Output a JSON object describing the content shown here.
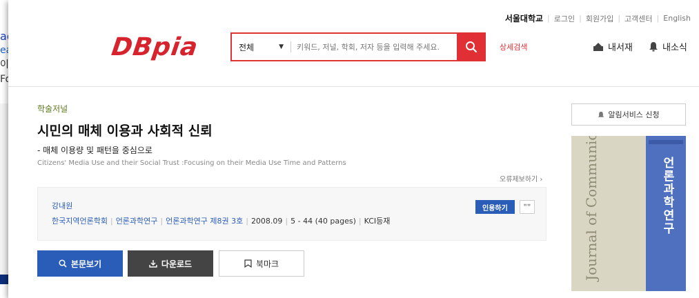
{
  "background_window": {
    "lines": [
      "ae",
      "ear",
      "이용.",
      "Foc"
    ]
  },
  "topbar": {
    "institution": "서울대학교",
    "links": [
      "로그인",
      "회원가입",
      "고객센터",
      "English"
    ]
  },
  "header": {
    "logo": "DBpia",
    "search": {
      "scope": "전체",
      "placeholder": "키워드, 저널, 학회, 저자 등을 입력해 주세요."
    },
    "advanced_search": "상세검색",
    "my_library": "내서재",
    "my_news": "내소식"
  },
  "article": {
    "category": "학술저널",
    "title": "시민의 매체 이용과 사회적 신뢰",
    "subtitle": "- 매체 이용량 및 패턴을 중심으로",
    "english_title": "Citizens' Media Use and their Social Trust :Focusing on their Media Use Time and Patterns",
    "report_error": "오류제보하기",
    "author": "강내원",
    "publisher": "한국지역언론학회",
    "journal": "언론과학연구",
    "issue": "언론과학연구 제8권 3호",
    "date": "2008.09",
    "pages": "5 - 44 (40 pages)",
    "index": "KCI등재",
    "cite_label": "인용하기",
    "quote_mark": "❞❞"
  },
  "actions": {
    "view": "본문보기",
    "download": "다운로드",
    "bookmark": "북마크"
  },
  "side": {
    "alert_service": "알림서비스 신청",
    "cover_title_en": "Journal of Communication Science",
    "cover_title_kr": "언론과학연구"
  },
  "colors": {
    "brand_red": "#e02f35",
    "link_blue": "#2a5db8",
    "category_green": "#5a7a1e"
  }
}
